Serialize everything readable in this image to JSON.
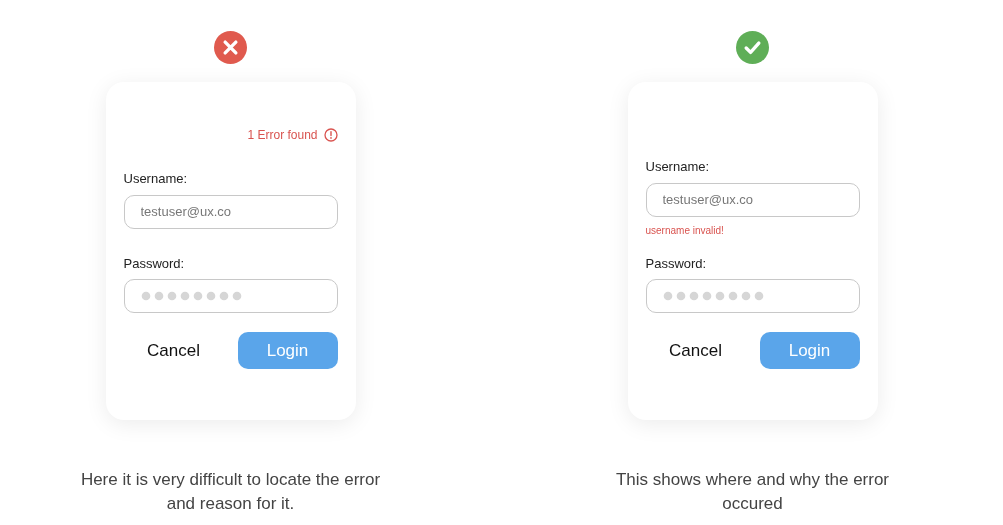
{
  "panels": [
    {
      "kind": "bad",
      "summary_error": "1 Error found",
      "username_label": "Username:",
      "username_value": "testuser@ux.co",
      "password_label": "Password:",
      "buttons": {
        "cancel": "Cancel",
        "login": "Login"
      },
      "caption": "Here it is very difficult to locate the error and reason for it."
    },
    {
      "kind": "good",
      "username_label": "Username:",
      "username_value": "testuser@ux.co",
      "field_error": "username invalid!",
      "password_label": "Password:",
      "buttons": {
        "cancel": "Cancel",
        "login": "Login"
      },
      "caption": "This shows where and why the error occured"
    }
  ]
}
